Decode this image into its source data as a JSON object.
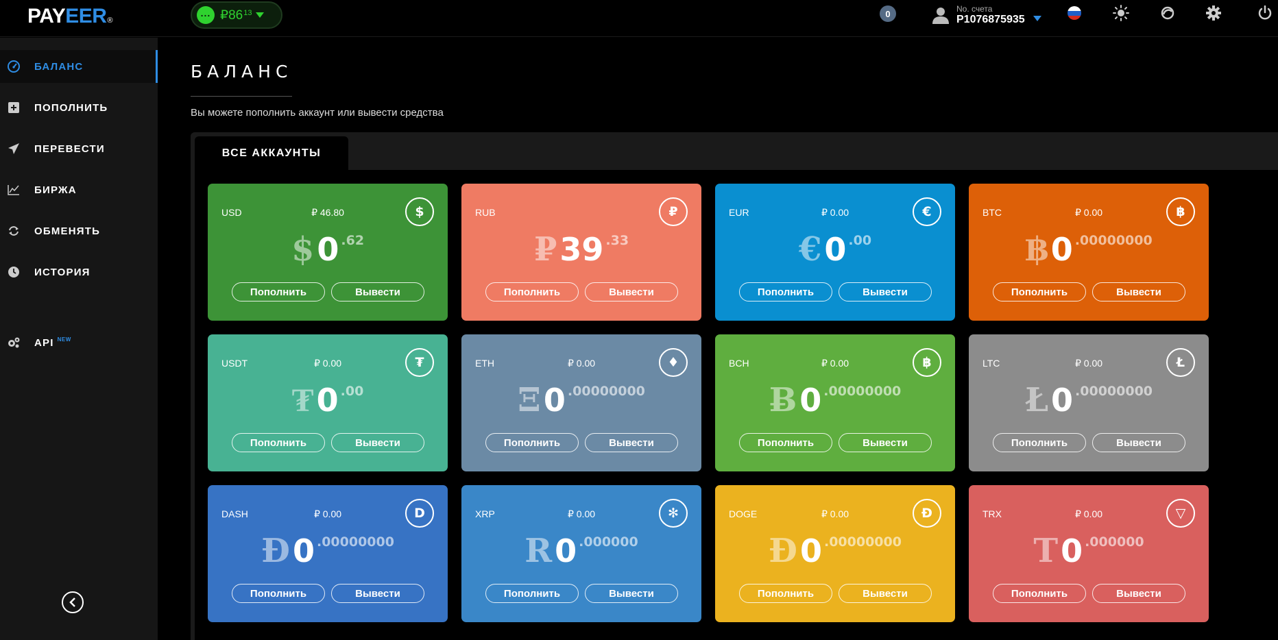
{
  "header": {
    "logo_pay": "PAY",
    "logo_eer": "EER",
    "logo_reg": "®",
    "balance_main": "₽86",
    "balance_frac": "13",
    "notifications": "0",
    "account_label": "No. счета",
    "account_number": "P1076875935"
  },
  "sidebar": {
    "items": [
      {
        "label": "БАЛАНС",
        "icon": "dashboard-icon",
        "active": true
      },
      {
        "label": "ПОПОЛНИТЬ",
        "icon": "plus-square-icon"
      },
      {
        "label": "ПЕРЕВЕСТИ",
        "icon": "paper-plane-icon"
      },
      {
        "label": "БИРЖА",
        "icon": "chart-icon"
      },
      {
        "label": "ОБМЕНЯТЬ",
        "icon": "exchange-icon"
      },
      {
        "label": "ИСТОРИЯ",
        "icon": "clock-icon"
      }
    ],
    "api_label": "API",
    "api_badge": "NEW"
  },
  "main": {
    "title": "БАЛАНС",
    "subtitle": "Вы можете пополнить аккаунт или вывести средства",
    "tab": "ВСЕ АККАУНТЫ",
    "deposit_label": "Пополнить",
    "withdraw_label": "Вывести"
  },
  "cards": [
    {
      "code": "USD",
      "conv": "₽ 46.80",
      "symbol": "$",
      "int": "0",
      "frac": ".62",
      "icon": "dollar-icon",
      "glyph": "$",
      "color": "#3d9337"
    },
    {
      "code": "RUB",
      "conv": "",
      "symbol": "₽",
      "int": "39",
      "frac": ".33",
      "icon": "ruble-icon",
      "glyph": "₽",
      "color": "#ef7b63"
    },
    {
      "code": "EUR",
      "conv": "₽ 0.00",
      "symbol": "€",
      "int": "0",
      "frac": ".00",
      "icon": "euro-icon",
      "glyph": "€",
      "color": "#0a8fd0"
    },
    {
      "code": "BTC",
      "conv": "₽ 0.00",
      "symbol": "฿",
      "int": "0",
      "frac": ".00000000",
      "icon": "bitcoin-icon",
      "glyph": "฿",
      "color": "#dd6008"
    },
    {
      "code": "USDT",
      "conv": "₽ 0.00",
      "symbol": "₮",
      "int": "0",
      "frac": ".00",
      "icon": "tether-icon",
      "glyph": "₮",
      "color": "#48b293"
    },
    {
      "code": "ETH",
      "conv": "₽ 0.00",
      "symbol": "Ξ",
      "int": "0",
      "frac": ".00000000",
      "icon": "ethereum-icon",
      "glyph": "♦",
      "color": "#6b8aa5"
    },
    {
      "code": "BCH",
      "conv": "₽ 0.00",
      "symbol": "Ƀ",
      "int": "0",
      "frac": ".00000000",
      "icon": "bitcoin-cash-icon",
      "glyph": "฿",
      "color": "#5fae3f"
    },
    {
      "code": "LTC",
      "conv": "₽ 0.00",
      "symbol": "Ł",
      "int": "0",
      "frac": ".00000000",
      "icon": "litecoin-icon",
      "glyph": "Ł",
      "color": "#8c8c8c"
    },
    {
      "code": "DASH",
      "conv": "₽ 0.00",
      "symbol": "Đ",
      "int": "0",
      "frac": ".00000000",
      "icon": "dash-icon",
      "glyph": "D",
      "color": "#3773c4"
    },
    {
      "code": "XRP",
      "conv": "₽ 0.00",
      "symbol": "R",
      "int": "0",
      "frac": ".000000",
      "icon": "ripple-icon",
      "glyph": "✻",
      "color": "#3a87c8"
    },
    {
      "code": "DOGE",
      "conv": "₽ 0.00",
      "symbol": "Đ",
      "int": "0",
      "frac": ".00000000",
      "icon": "dogecoin-icon",
      "glyph": "Đ",
      "color": "#ebb21f"
    },
    {
      "code": "TRX",
      "conv": "₽ 0.00",
      "symbol": "T",
      "int": "0",
      "frac": ".000000",
      "icon": "tron-icon",
      "glyph": "▽",
      "color": "#d9605e"
    }
  ]
}
